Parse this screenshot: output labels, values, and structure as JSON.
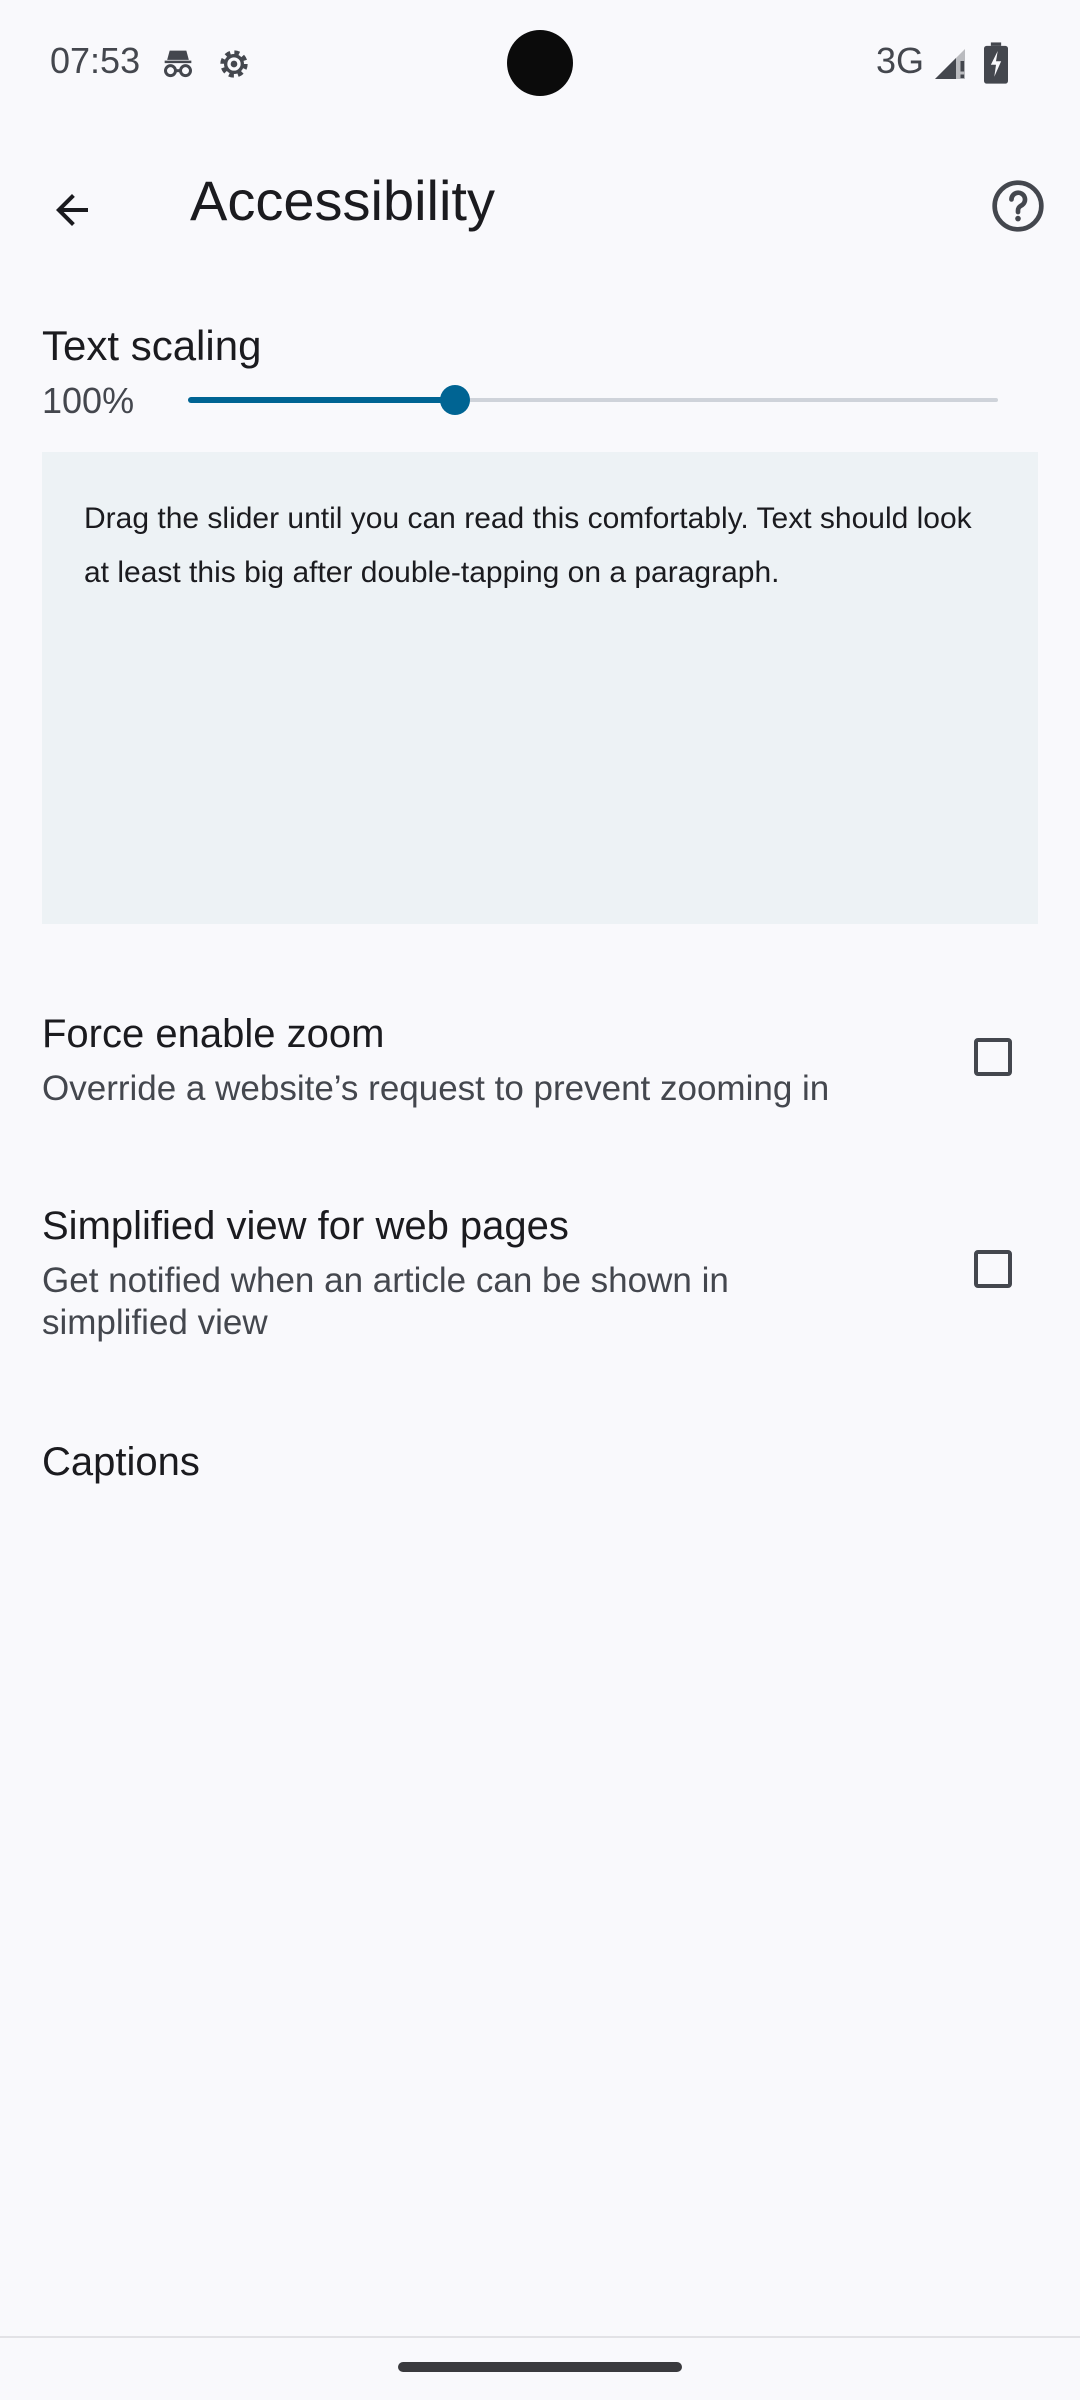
{
  "status_bar": {
    "time": "07:53",
    "icons": [
      "incognito-icon",
      "settings-gear-icon"
    ],
    "network": "3G",
    "signal_icon": "signal-icon",
    "battery_icon": "battery-charging-icon"
  },
  "app_bar": {
    "title": "Accessibility",
    "back_icon": "arrow-back-icon",
    "help_icon": "help-circle-icon"
  },
  "text_scaling": {
    "title": "Text scaling",
    "value_label": "100%",
    "slider_fraction": 0.33,
    "preview_text": "Drag the slider until you can read this comfortably. Text should look at least this big after double-tapping on a paragraph."
  },
  "settings": [
    {
      "title": "Force enable zoom",
      "summary": "Override a website’s request to prevent zooming in",
      "checked": false
    },
    {
      "title": "Simplified view for web pages",
      "summary": "Get notified when an article can be shown in simplified view",
      "checked": false
    }
  ],
  "captions": {
    "title": "Captions"
  },
  "colors": {
    "accent": "#006493",
    "background": "#f9f9fc",
    "preview_background": "#edf2f5"
  }
}
